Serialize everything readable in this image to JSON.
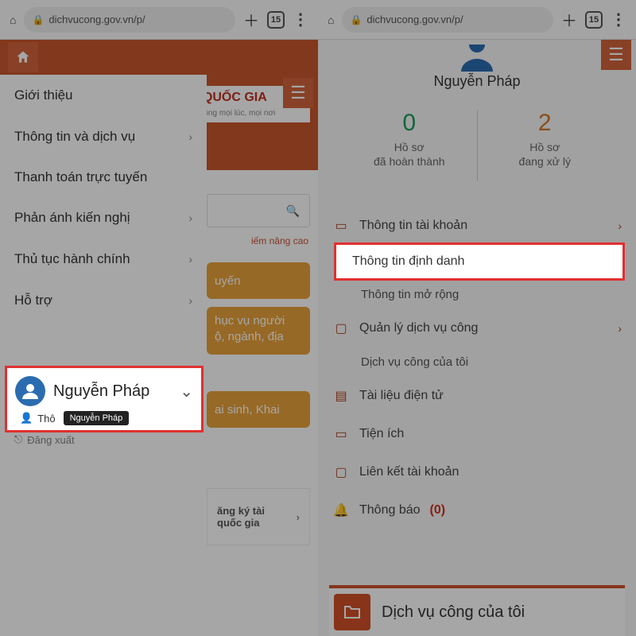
{
  "browser": {
    "url": "dichvucong.gov.vn/p/",
    "tab_count": "15"
  },
  "left": {
    "sidebar": [
      "Giới thiệu",
      "Thông tin và dịch vụ",
      "Thanh toán trực tuyến",
      "Phản ánh kiến nghị",
      "Thủ tục hành chính",
      "Hỗ trợ"
    ],
    "user_name": "Nguyễn Pháp",
    "user_sub_prefix": "Thô",
    "tooltip": "Nguyễn Pháp",
    "logout": "Đăng xuất",
    "peek": {
      "title_suffix": "G QUỐC GIA",
      "tagline_suffix": "vụ công mọi lúc, mọi nơi",
      "adv_search": "iếm nâng cao",
      "card1": "uyến",
      "card2_l1": "hục vụ người",
      "card2_l2": "ộ, ngành, địa",
      "card3": "ai sinh, Khai",
      "register_l1": "ăng ký tài",
      "register_l2": "quốc gia"
    }
  },
  "right": {
    "user_name": "Nguyễn Pháp",
    "stats": {
      "done_num": "0",
      "done_label": "Hồ sơ\nđã hoàn thành",
      "proc_num": "2",
      "proc_label": "Hồ sơ\nđang xử lý"
    },
    "menu": {
      "account_info": "Thông tin tài khoản",
      "identity_info": "Thông tin định danh",
      "extended_info": "Thông tin mở rộng",
      "manage_services": "Quản lý dịch vụ công",
      "my_services_sub": "Dịch vụ công của tôi",
      "edoc": "Tài liệu điện tử",
      "utils": "Tiện ích",
      "link_account": "Liên kết tài khoản",
      "notifications": "Thông báo",
      "noti_count": "(0)"
    },
    "cta": "Dịch vụ công của tôi"
  }
}
